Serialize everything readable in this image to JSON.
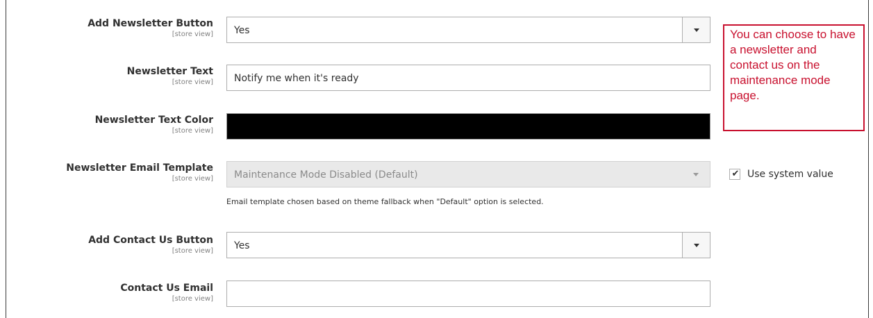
{
  "fields": [
    {
      "label": "Add Newsletter Button",
      "scope": "[store view]",
      "value": "Yes",
      "type": "select"
    },
    {
      "label": "Newsletter Text",
      "scope": "[store view]",
      "value": "Notify me when it's ready",
      "type": "text"
    },
    {
      "label": "Newsletter Text Color",
      "scope": "[store view]",
      "value": "",
      "color": "#000000",
      "type": "color"
    },
    {
      "label": "Newsletter Email Template",
      "scope": "[store view]",
      "value": "Maintenance Mode Disabled (Default)",
      "type": "select",
      "disabled": true,
      "note": "Email template chosen based on theme fallback when \"Default\" option is selected.",
      "use_system_value": {
        "label": "Use system value",
        "checked": true
      }
    },
    {
      "label": "Add Contact Us Button",
      "scope": "[store view]",
      "value": "Yes",
      "type": "select"
    },
    {
      "label": "Contact Us Email",
      "scope": "[store view]",
      "value": "",
      "type": "text"
    }
  ],
  "callout": {
    "text": "You can choose to have a newsletter and contact us on the maintenance mode page.",
    "color": "#c8102e"
  },
  "icons": {
    "dropdown": "chevron-down-icon",
    "checkbox": "checkmark-icon"
  }
}
